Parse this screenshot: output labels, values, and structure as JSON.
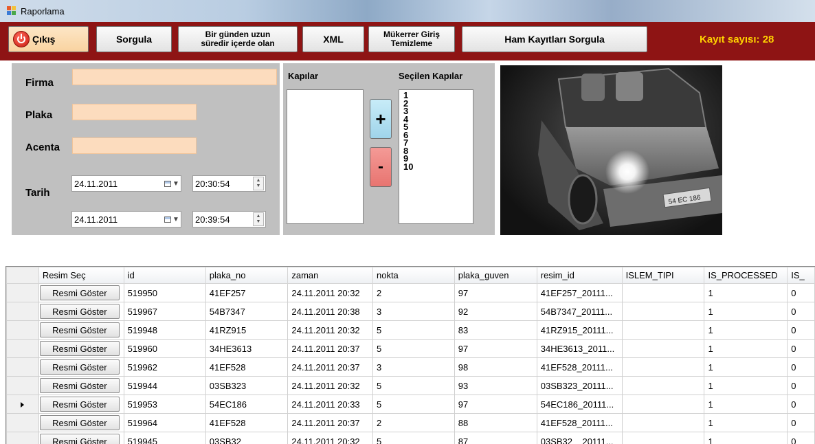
{
  "window": {
    "title": "Raporlama"
  },
  "toolbar": {
    "exit_label": "Çıkış",
    "query_label": "Sorgula",
    "long_stay_line1": "Bir günden uzun",
    "long_stay_line2": "süredir içerde olan",
    "xml_label": "XML",
    "dup_line1": "Mükerrer Giriş",
    "dup_line2": "Temizleme",
    "raw_query_label": "Ham Kayıtları Sorgula",
    "record_count_label": "Kayıt sayısı:",
    "record_count_value": "28",
    "bg_color": "#8e1414",
    "count_color": "#ffd200"
  },
  "filters": {
    "firma_label": "Firma",
    "plaka_label": "Plaka",
    "acenta_label": "Acenta",
    "tarih_label": "Tarih",
    "firma_value": "",
    "plaka_value": "",
    "acenta_value": "",
    "start_date": "24.11.2011",
    "start_time": "20:30:54",
    "end_date": "24.11.2011",
    "end_time": "20:39:54",
    "input_color": "#fcdcbe"
  },
  "doors": {
    "available_label": "Kapılar",
    "selected_label": "Seçilen Kapılar",
    "available": [],
    "selected": [
      "1",
      "2",
      "3",
      "4",
      "5",
      "6",
      "7",
      "8",
      "9",
      "10"
    ],
    "add_symbol": "+",
    "remove_symbol": "-"
  },
  "camera": {
    "plate_text": "54 EC 186"
  },
  "grid": {
    "columns": [
      "Resim Seç",
      "id",
      "plaka_no",
      "zaman",
      "nokta",
      "plaka_guven",
      "resim_id",
      "ISLEM_TIPI",
      "IS_PROCESSED",
      "IS_"
    ],
    "button_label": "Resmi Göster",
    "rows": [
      {
        "id": "519950",
        "plaka_no": "41EF257",
        "zaman": "24.11.2011 20:32",
        "nokta": "2",
        "plaka_guven": "97",
        "resim_id": "41EF257_20111...",
        "islem_tipi": "",
        "is_processed": "1",
        "is_x": "0",
        "current": false
      },
      {
        "id": "519967",
        "plaka_no": "54B7347",
        "zaman": "24.11.2011 20:38",
        "nokta": "3",
        "plaka_guven": "92",
        "resim_id": "54B7347_20111...",
        "islem_tipi": "",
        "is_processed": "1",
        "is_x": "0",
        "current": false
      },
      {
        "id": "519948",
        "plaka_no": "41RZ915",
        "zaman": "24.11.2011 20:32",
        "nokta": "5",
        "plaka_guven": "83",
        "resim_id": "41RZ915_20111...",
        "islem_tipi": "",
        "is_processed": "1",
        "is_x": "0",
        "current": false
      },
      {
        "id": "519960",
        "plaka_no": "34HE3613",
        "zaman": "24.11.2011 20:37",
        "nokta": "5",
        "plaka_guven": "97",
        "resim_id": "34HE3613_2011...",
        "islem_tipi": "",
        "is_processed": "1",
        "is_x": "0",
        "current": false
      },
      {
        "id": "519962",
        "plaka_no": "41EF528",
        "zaman": "24.11.2011 20:37",
        "nokta": "3",
        "plaka_guven": "98",
        "resim_id": "41EF528_20111...",
        "islem_tipi": "",
        "is_processed": "1",
        "is_x": "0",
        "current": false
      },
      {
        "id": "519944",
        "plaka_no": "03SB323",
        "zaman": "24.11.2011 20:32",
        "nokta": "5",
        "plaka_guven": "93",
        "resim_id": "03SB323_20111...",
        "islem_tipi": "",
        "is_processed": "1",
        "is_x": "0",
        "current": false
      },
      {
        "id": "519953",
        "plaka_no": "54EC186",
        "zaman": "24.11.2011 20:33",
        "nokta": "5",
        "plaka_guven": "97",
        "resim_id": "54EC186_20111...",
        "islem_tipi": "",
        "is_processed": "1",
        "is_x": "0",
        "current": true
      },
      {
        "id": "519964",
        "plaka_no": "41EF528",
        "zaman": "24.11.2011 20:37",
        "nokta": "2",
        "plaka_guven": "88",
        "resim_id": "41EF528_20111...",
        "islem_tipi": "",
        "is_processed": "1",
        "is_x": "0",
        "current": false
      },
      {
        "id": "519945",
        "plaka_no": "03SB32",
        "zaman": "24.11.2011 20:32",
        "nokta": "5",
        "plaka_guven": "87",
        "resim_id": "03SB32__20111...",
        "islem_tipi": "",
        "is_processed": "1",
        "is_x": "0",
        "current": false
      }
    ]
  }
}
